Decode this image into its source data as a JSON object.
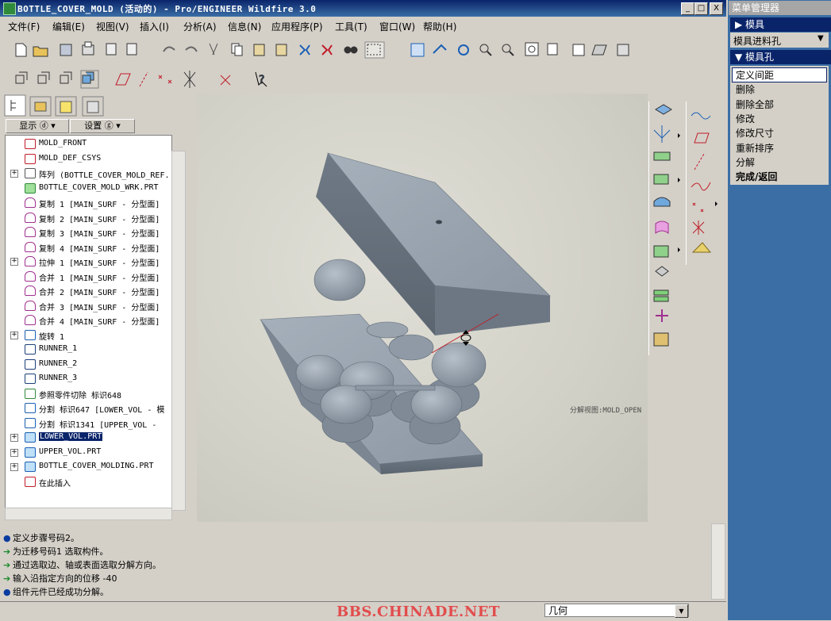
{
  "window": {
    "title": "BOTTLE_COVER_MOLD (活动的) - Pro/ENGINEER Wildfire 3.0",
    "buttons": [
      "_",
      "□",
      "X"
    ]
  },
  "menubar": {
    "items": [
      "文件(F)",
      "编辑(E)",
      "视图(V)",
      "插入(I)",
      "分析(A)",
      "信息(N)",
      "应用程序(P)",
      "工具(T)",
      "窗口(W)",
      "帮助(H)"
    ]
  },
  "navigator": {
    "tabs": [
      "model-tree-tab",
      "folder-tab",
      "favorites-tab",
      "layer-tab"
    ],
    "show_label": "显示 ⓓ ▾",
    "settings_label": "设置 ⓖ ▾",
    "nodes": [
      {
        "label": "MOLD_FRONT",
        "icon": "datum-plane-icon",
        "expand": ""
      },
      {
        "label": "MOLD_DEF_CSYS",
        "icon": "csys-icon",
        "expand": ""
      },
      {
        "label": "阵列 (BOTTLE_COVER_MOLD_REF.",
        "icon": "pattern-icon",
        "expand": "+"
      },
      {
        "label": "BOTTLE_COVER_MOLD_WRK.PRT",
        "icon": "part-icon",
        "expand": ""
      },
      {
        "label": "复制 1 [MAIN_SURF - 分型面]",
        "icon": "surface-icon",
        "expand": ""
      },
      {
        "label": "复制 2 [MAIN_SURF - 分型面]",
        "icon": "surface-icon",
        "expand": ""
      },
      {
        "label": "复制 3 [MAIN_SURF - 分型面]",
        "icon": "surface-icon",
        "expand": ""
      },
      {
        "label": "复制 4 [MAIN_SURF - 分型面]",
        "icon": "surface-icon",
        "expand": ""
      },
      {
        "label": "拉伸 1 [MAIN_SURF - 分型面]",
        "icon": "surface-icon",
        "expand": "+"
      },
      {
        "label": "合并 1 [MAIN_SURF - 分型面]",
        "icon": "surface-icon",
        "expand": ""
      },
      {
        "label": "合并 2 [MAIN_SURF - 分型面]",
        "icon": "surface-icon",
        "expand": ""
      },
      {
        "label": "合并 3 [MAIN_SURF - 分型面]",
        "icon": "surface-icon",
        "expand": ""
      },
      {
        "label": "合并 4 [MAIN_SURF - 分型面]",
        "icon": "surface-icon",
        "expand": ""
      },
      {
        "label": "旋转 1",
        "icon": "revolve-icon",
        "expand": "+"
      },
      {
        "label": "RUNNER_1",
        "icon": "runner-icon",
        "expand": ""
      },
      {
        "label": "RUNNER_2",
        "icon": "runner-icon",
        "expand": ""
      },
      {
        "label": "RUNNER_3",
        "icon": "runner-icon",
        "expand": ""
      },
      {
        "label": "参照零件切除 标识648",
        "icon": "cut-icon",
        "expand": ""
      },
      {
        "label": "分割 标识647 [LOWER_VOL - 模",
        "icon": "split-icon",
        "expand": ""
      },
      {
        "label": "分割 标识1341 [UPPER_VOL -",
        "icon": "split-icon",
        "expand": ""
      },
      {
        "label": "LOWER_VOL.PRT",
        "icon": "volume-icon",
        "expand": "+",
        "selected": true
      },
      {
        "label": "UPPER_VOL.PRT",
        "icon": "volume-icon",
        "expand": "+"
      },
      {
        "label": "BOTTLE_COVER_MOLDING.PRT",
        "icon": "molding-icon",
        "expand": "+"
      },
      {
        "label": "在此插入",
        "icon": "insert-arrow-icon",
        "expand": ""
      }
    ]
  },
  "viewport": {
    "view_label": "分解视图:MOLD_OPEN"
  },
  "menu_manager": {
    "title": "菜单管理器",
    "bar_mold": "▶ 模具",
    "sprue_label": "模具进料孔",
    "bar_sprue": "▼ 模具孔",
    "items": [
      "定义间距",
      "删除",
      "删除全部",
      "修改",
      "修改尺寸",
      "重新排序",
      "分解",
      "完成/返回"
    ],
    "selected_index": 0
  },
  "messages": [
    {
      "type": "info",
      "text": "定义步骤号码2。"
    },
    {
      "type": "prompt",
      "text": "为迁移号码1 选取构件。"
    },
    {
      "type": "prompt",
      "text": "通过选取边、轴或表面选取分解方向。"
    },
    {
      "type": "prompt",
      "text": "输入沿指定方向的位移    -40"
    },
    {
      "type": "info",
      "text": "组件元件已经成功分解。"
    }
  ],
  "statusbar": {
    "watermark": "BBS.CHINADE.NET",
    "filter_value": "几何"
  },
  "colors": {
    "title_bar": "#0a246a",
    "menu_manager_bg": "#3b6ea5",
    "selection": "#0a246a",
    "mold_face": "#8c97a3",
    "watermark": "#e24d4d"
  }
}
